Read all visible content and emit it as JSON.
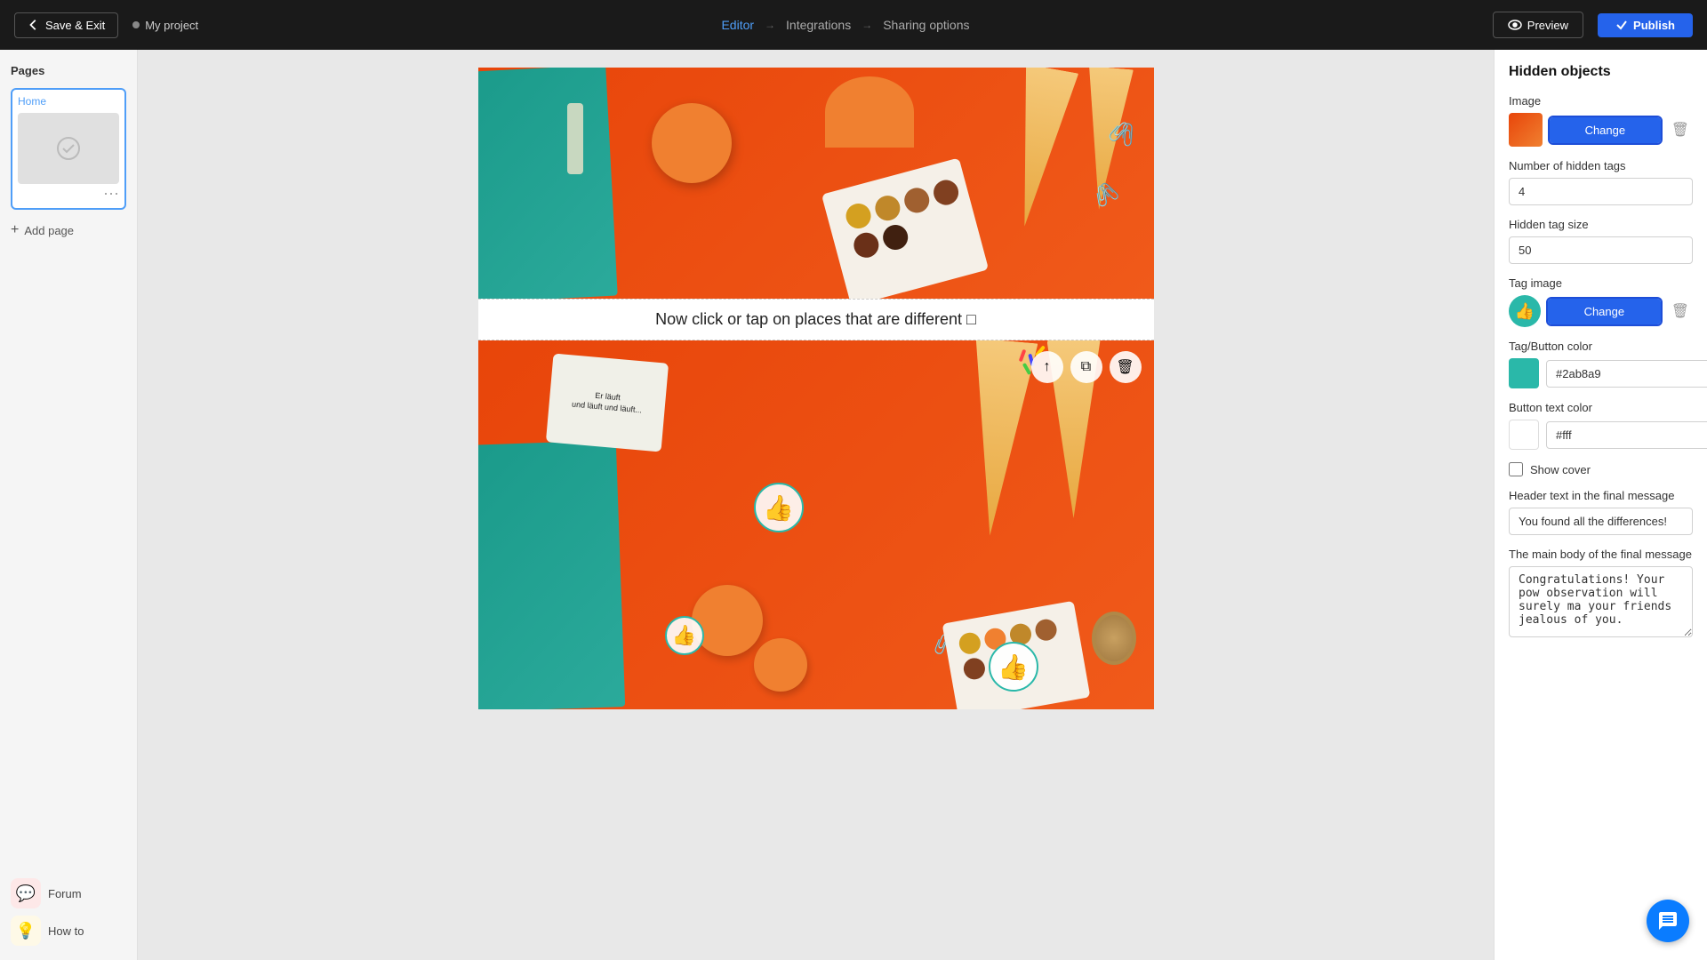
{
  "topbar": {
    "save_exit_label": "Save & Exit",
    "project_name": "My project",
    "nav_steps": [
      {
        "label": "Editor",
        "active": true
      },
      {
        "label": "Integrations",
        "active": false
      },
      {
        "label": "Sharing options",
        "active": false
      }
    ],
    "preview_label": "Preview",
    "publish_label": "Publish"
  },
  "sidebar": {
    "title": "Pages",
    "pages": [
      {
        "label": "Home",
        "active": true
      }
    ],
    "add_page_label": "Add page",
    "bottom_items": [
      {
        "label": "Forum",
        "icon": "💬"
      },
      {
        "label": "How to",
        "icon": "💡"
      }
    ]
  },
  "canvas": {
    "instruction_text": "Now click or tap on places that are different",
    "checkbox_symbol": "□"
  },
  "right_panel": {
    "title": "Hidden objects",
    "image_section": {
      "label": "Image",
      "change_btn": "Change"
    },
    "num_hidden_tags": {
      "label": "Number of hidden tags",
      "value": "4"
    },
    "hidden_tag_size": {
      "label": "Hidden tag size",
      "value": "50"
    },
    "tag_image": {
      "label": "Tag image",
      "change_btn": "Change"
    },
    "tag_button_color": {
      "label": "Tag/Button color",
      "value": "#2ab8a9"
    },
    "button_text_color": {
      "label": "Button text color",
      "value": "#fff"
    },
    "show_cover": {
      "label": "Show cover",
      "checked": false
    },
    "header_text": {
      "label": "Header text in the final message",
      "value": "You found all the differences!"
    },
    "main_body": {
      "label": "The main body of the final message",
      "value": "Congratulations! Your pow observation will surely ma your friends jealous of you."
    }
  }
}
